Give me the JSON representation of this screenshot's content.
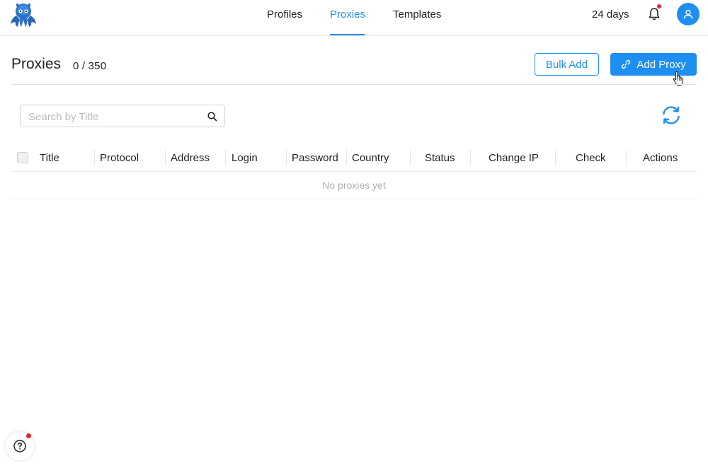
{
  "nav": {
    "items": [
      {
        "label": "Profiles",
        "active": false
      },
      {
        "label": "Proxies",
        "active": true
      },
      {
        "label": "Templates",
        "active": false
      }
    ],
    "subscription_days": "24 days",
    "icons": {
      "logo": "octopus-logo",
      "notifications": "bell-icon",
      "account": "user-icon"
    }
  },
  "page": {
    "title": "Proxies",
    "count": "0 / 350"
  },
  "toolbar": {
    "bulk_add_label": "Bulk Add",
    "add_proxy_label": "Add Proxy"
  },
  "search": {
    "placeholder": "Search by Title",
    "value": ""
  },
  "table": {
    "columns": [
      "Title",
      "Protocol",
      "Address",
      "Login",
      "Password",
      "Country",
      "Status",
      "Change IP",
      "Check",
      "Actions"
    ],
    "empty_text": "No proxies yet"
  },
  "colors": {
    "accent": "#1f8ef1",
    "notification_dot": "#e3262a"
  }
}
